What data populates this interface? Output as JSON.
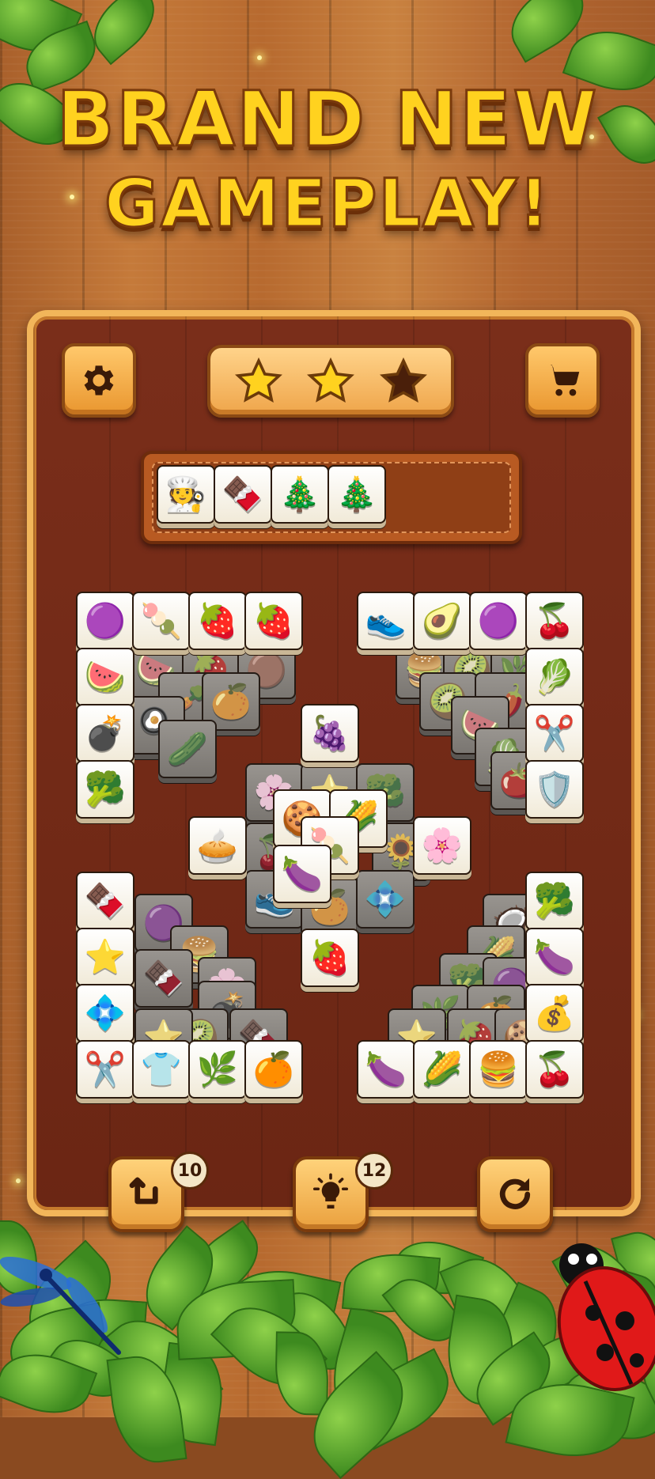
{
  "headline": {
    "line1": "BRAND NEW",
    "line2": "GAMEPLAY!"
  },
  "top_bar": {
    "settings_icon": "gear-icon",
    "shop_icon": "cart-icon",
    "stars": {
      "earned": 2,
      "total": 3
    }
  },
  "tray": {
    "capacity": 7,
    "tiles": [
      "🧑‍🍳",
      "🍫",
      "🎄",
      "🎄"
    ],
    "tile_names": [
      "gingerbread",
      "ice-cream-bar",
      "holly",
      "holly"
    ]
  },
  "board_tiles": {
    "top_left_row": [
      "🟣",
      "🍡",
      "🍓",
      "🍓"
    ],
    "top_right_row": [
      "👟",
      "🥑",
      "🟣",
      "🍒"
    ],
    "left_column_top": [
      "🍉",
      "💣",
      "🥦"
    ],
    "right_column_top": [
      "🥬",
      "✂️",
      "🛡️"
    ],
    "center": [
      "🍇",
      "🍪",
      "🌽",
      "🍡",
      "🥧",
      "🌸",
      "🍆",
      "🍓"
    ],
    "left_column_bottom": [
      "🍫",
      "⭐",
      "💠"
    ],
    "right_column_bottom": [
      "🥦",
      "🍆",
      "💰"
    ],
    "bottom_left_row": [
      "✂️",
      "👕",
      "🌿",
      "🍊"
    ],
    "bottom_right_row": [
      "🍆",
      "🌽",
      "🍔",
      "🍒"
    ]
  },
  "bottom_bar": {
    "undo": {
      "icon": "undo-arrow-icon",
      "count": "10"
    },
    "hint": {
      "icon": "lightbulb-icon",
      "count": "12"
    },
    "shuffle": {
      "icon": "refresh-icon"
    }
  },
  "colors": {
    "accent": "#ffd21f",
    "board": "#7a2e1a",
    "button": "#efa54a"
  }
}
